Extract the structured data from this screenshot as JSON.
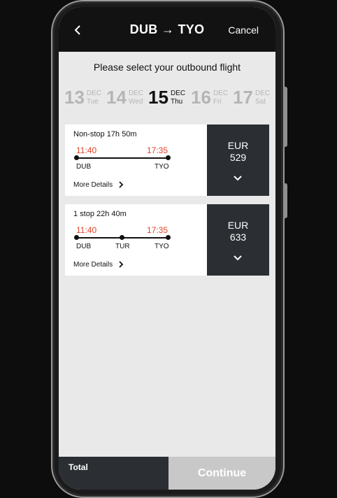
{
  "header": {
    "title": "DUB → TYO",
    "cancel_label": "Cancel"
  },
  "subtitle": "Please select your outbound flight",
  "dates": [
    {
      "num": "13",
      "month": "DEC",
      "day": "Tue",
      "selected": false
    },
    {
      "num": "14",
      "month": "DEC",
      "day": "Wed",
      "selected": false
    },
    {
      "num": "15",
      "month": "DEC",
      "day": "Thu",
      "selected": true
    },
    {
      "num": "16",
      "month": "DEC",
      "day": "Fri",
      "selected": false
    },
    {
      "num": "17",
      "month": "DEC",
      "day": "Sat",
      "selected": false
    }
  ],
  "flights": [
    {
      "duration": "Non-stop 17h 50m",
      "depart_time": "11:40",
      "arrive_time": "17:35",
      "airports": [
        "DUB",
        "TYO"
      ],
      "more_details_label": "More Details",
      "currency": "EUR",
      "price": "529"
    },
    {
      "duration": "1 stop 22h 40m",
      "depart_time": "11:40",
      "arrive_time": "17:35",
      "airports": [
        "DUB",
        "TUR",
        "TYO"
      ],
      "more_details_label": "More Details",
      "currency": "EUR",
      "price": "633"
    }
  ],
  "footer": {
    "total_label": "Total",
    "continue_label": "Continue"
  },
  "colors": {
    "accent_time": "#e0442b",
    "price_panel": "#2b2e33",
    "continue_disabled": "#c8c8c8"
  }
}
